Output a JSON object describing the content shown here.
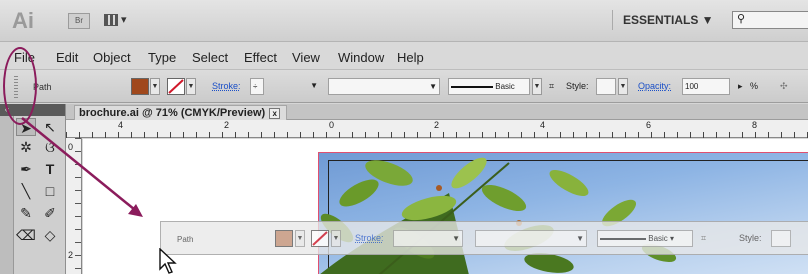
{
  "app": {
    "logo": "Ai",
    "br_button": "Br",
    "workspace": "ESSENTIALS ▼",
    "search_placeholder": ""
  },
  "menu": [
    "File",
    "Edit",
    "Object",
    "Type",
    "Select",
    "Effect",
    "View",
    "Window",
    "Help"
  ],
  "control_bar": {
    "selection_label": "Path",
    "fill_color": "#a0481c",
    "stroke_label": "Stroke:",
    "stroke_value": "",
    "brush_label": "Basic",
    "style_label": "Style:",
    "opacity_label": "Opacity:",
    "opacity_value": "100",
    "percent_label": "%"
  },
  "document": {
    "tab_title": "brochure.ai @ 71% (CMYK/Preview)",
    "close": "x"
  },
  "ruler": {
    "h_labels": [
      "4",
      "2",
      "0",
      "2",
      "4",
      "6",
      "8"
    ],
    "v_labels": [
      "0",
      "2"
    ]
  },
  "floating_bar": {
    "selection_label": "Path",
    "fill_color": "#c89a82",
    "stroke_label": "Stroke:",
    "brush_label": "Basic",
    "style_label": "Style:"
  },
  "colors": {
    "annotation": "#8b1c5c",
    "accent_link": "#1a4fc7"
  }
}
